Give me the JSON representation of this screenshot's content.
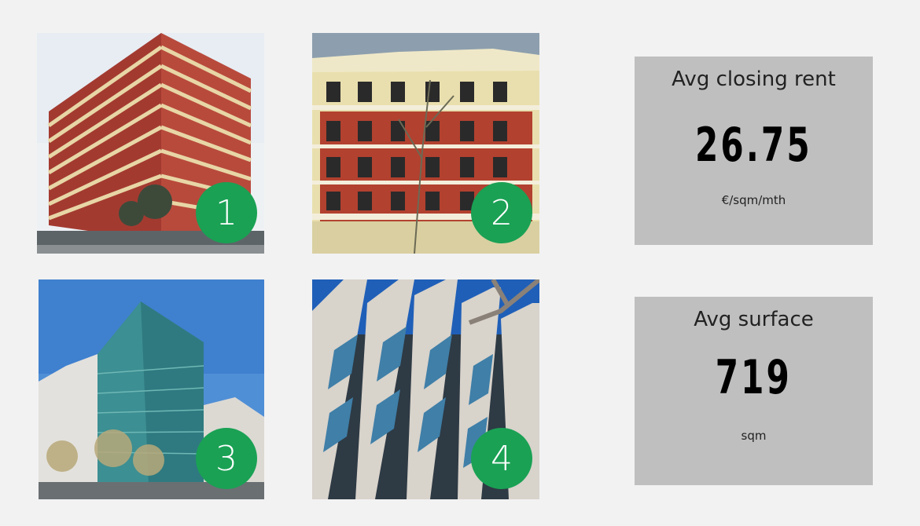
{
  "colors": {
    "background": "#f2f2f2",
    "badge_green": "#1aa154",
    "stat_panel": "#bfbfbf"
  },
  "buildings": [
    {
      "badge": "1"
    },
    {
      "badge": "2"
    },
    {
      "badge": "3"
    },
    {
      "badge": "4"
    }
  ],
  "stats": [
    {
      "label": "Avg closing rent",
      "value": "26.75",
      "unit": "€/sqm/mth"
    },
    {
      "label": "Avg surface",
      "value": "719",
      "unit": "sqm"
    }
  ]
}
